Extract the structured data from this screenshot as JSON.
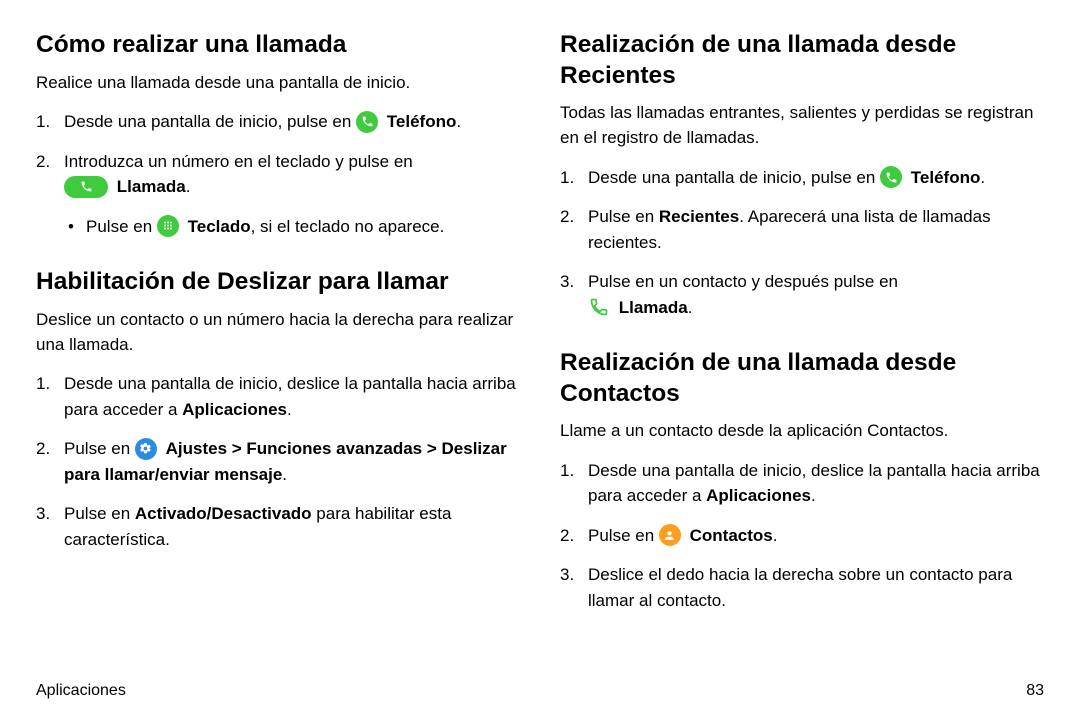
{
  "left": {
    "section1": {
      "heading": "Cómo realizar una llamada",
      "intro": "Realice una llamada desde una pantalla de inicio.",
      "steps": [
        {
          "pre": "Desde una pantalla de inicio, pulse en ",
          "icon": "phone-circle",
          "bold": "Teléfono",
          "post": "."
        },
        {
          "pre": "Introduzca un número en el teclado y pulse en",
          "icon_below": true,
          "icon": "call-pill",
          "bold": "Llamada",
          "post": "."
        }
      ],
      "sub": {
        "pre": "Pulse en ",
        "icon": "keypad-circle",
        "bold": "Teclado",
        "post": ", si el teclado no aparece."
      }
    },
    "section2": {
      "heading": "Habilitación de Deslizar para llamar",
      "intro": "Deslice un contacto o un número hacia la derecha para realizar una llamada.",
      "steps": [
        {
          "text_pre": "Desde una pantalla de inicio, deslice la pantalla hacia arriba para acceder a ",
          "bold1": "Aplicaciones",
          "text_post": "."
        },
        {
          "text_pre": "Pulse en ",
          "icon": "settings-circle",
          "bold_chain": "Ajustes > Funciones avanzadas > Deslizar para llamar/enviar mensaje",
          "text_post": "."
        },
        {
          "text_pre": "Pulse en ",
          "bold1": "Activado/Desactivado",
          "text_post": " para habilitar esta característica."
        }
      ]
    }
  },
  "right": {
    "section1": {
      "heading": "Realización de una llamada desde Recientes",
      "intro": "Todas las llamadas entrantes, salientes y perdidas se registran en el registro de llamadas.",
      "steps": [
        {
          "pre": "Desde una pantalla de inicio, pulse en ",
          "icon": "phone-circle",
          "bold": "Teléfono",
          "post": "."
        },
        {
          "pre": "Pulse en ",
          "bold": "Recientes",
          "post": ". Aparecerá una lista de llamadas recientes."
        },
        {
          "pre": "Pulse en un contacto y después pulse en",
          "icon_below": true,
          "icon": "call-outline",
          "bold_after": "Llamada",
          "post": "."
        }
      ]
    },
    "section2": {
      "heading": "Realización de una llamada desde Contactos",
      "intro": "Llame a un contacto desde la aplicación Contactos.",
      "steps": [
        {
          "pre": "Desde una pantalla de inicio, deslice la pantalla hacia arriba para acceder a ",
          "bold": "Aplicaciones",
          "post": "."
        },
        {
          "pre": "Pulse en ",
          "icon": "contacts-circle",
          "bold": "Contactos",
          "post": "."
        },
        {
          "pre": "Deslice el dedo hacia la derecha sobre un contacto para llamar al contacto."
        }
      ]
    }
  },
  "footer": {
    "section": "Aplicaciones",
    "page": "83"
  }
}
